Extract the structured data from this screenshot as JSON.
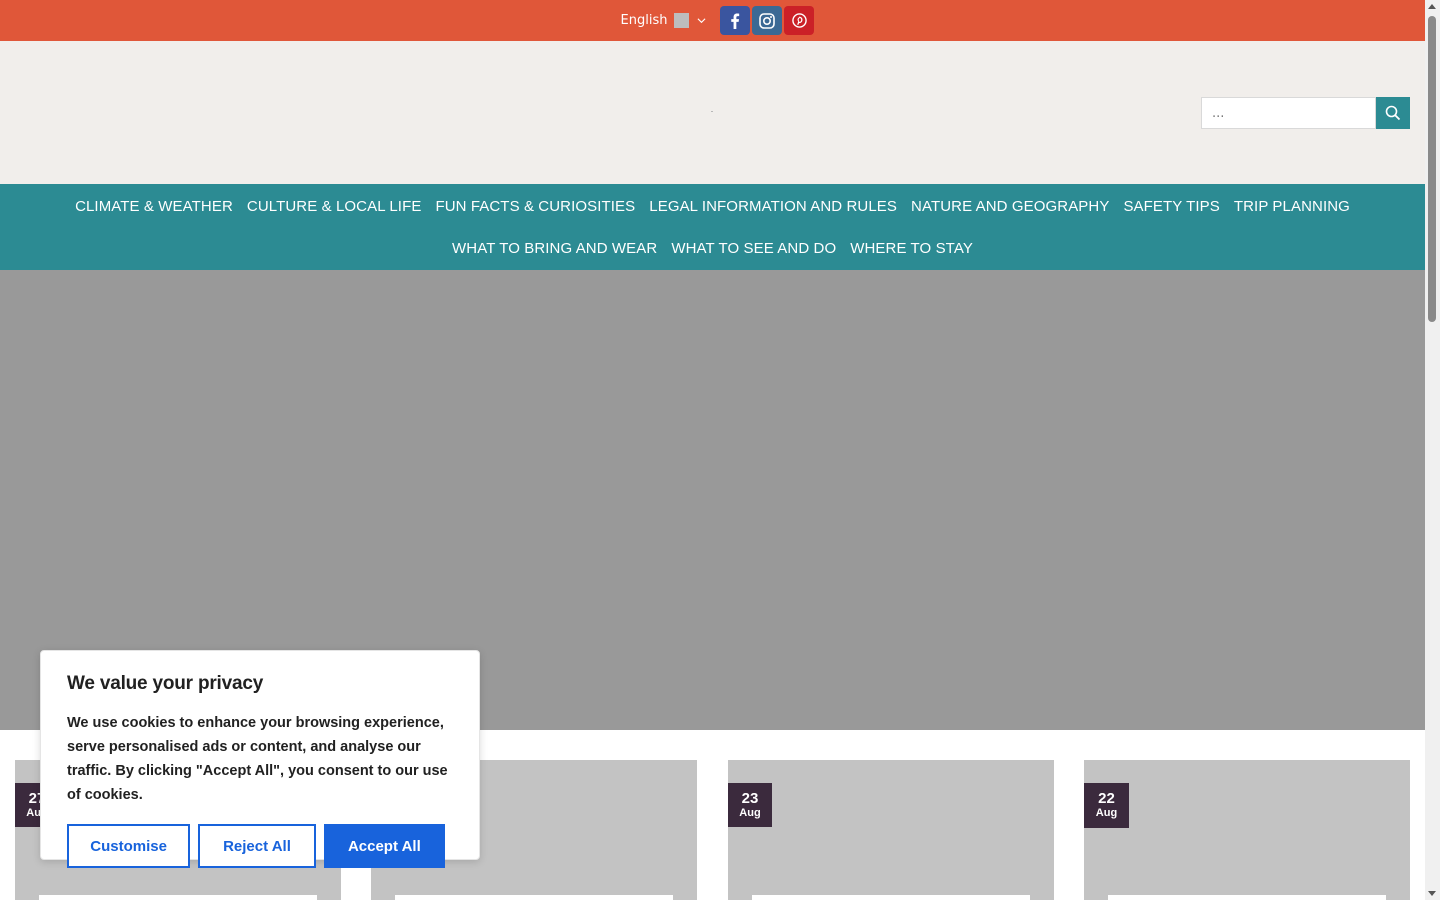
{
  "topbar": {
    "language": "English",
    "social": [
      {
        "name": "facebook",
        "icon": "facebook-icon"
      },
      {
        "name": "instagram",
        "icon": "instagram-icon"
      },
      {
        "name": "pinterest",
        "icon": "pinterest-icon"
      }
    ]
  },
  "search": {
    "placeholder": "..."
  },
  "nav": {
    "row1": [
      "CLIMATE & WEATHER",
      "CULTURE & LOCAL LIFE",
      "FUN FACTS & CURIOSITIES",
      "LEGAL INFORMATION AND RULES",
      "NATURE AND GEOGRAPHY",
      "SAFETY TIPS",
      "TRIP PLANNING"
    ],
    "row2": [
      "WHAT TO BRING AND WEAR",
      "WHAT TO SEE AND DO",
      "WHERE TO STAY"
    ]
  },
  "cards": [
    {
      "day": "27",
      "month": "Aug"
    },
    {
      "day": "",
      "month": ""
    },
    {
      "day": "23",
      "month": "Aug"
    },
    {
      "day": "22",
      "month": "Aug"
    }
  ],
  "cookie": {
    "title": "We value your privacy",
    "text": "We use cookies to enhance your browsing experience, serve personalised ads or content, and analyse our traffic. By clicking \"Accept All\", you consent to our use of cookies.",
    "customise": "Customise",
    "reject": "Reject All",
    "accept": "Accept All"
  },
  "colors": {
    "topbar": "#e05739",
    "header": "#f1eeeb",
    "nav": "#2c8b93",
    "hero": "#999999",
    "badge": "#3b2a3d",
    "cookie_accent": "#1863dc"
  }
}
